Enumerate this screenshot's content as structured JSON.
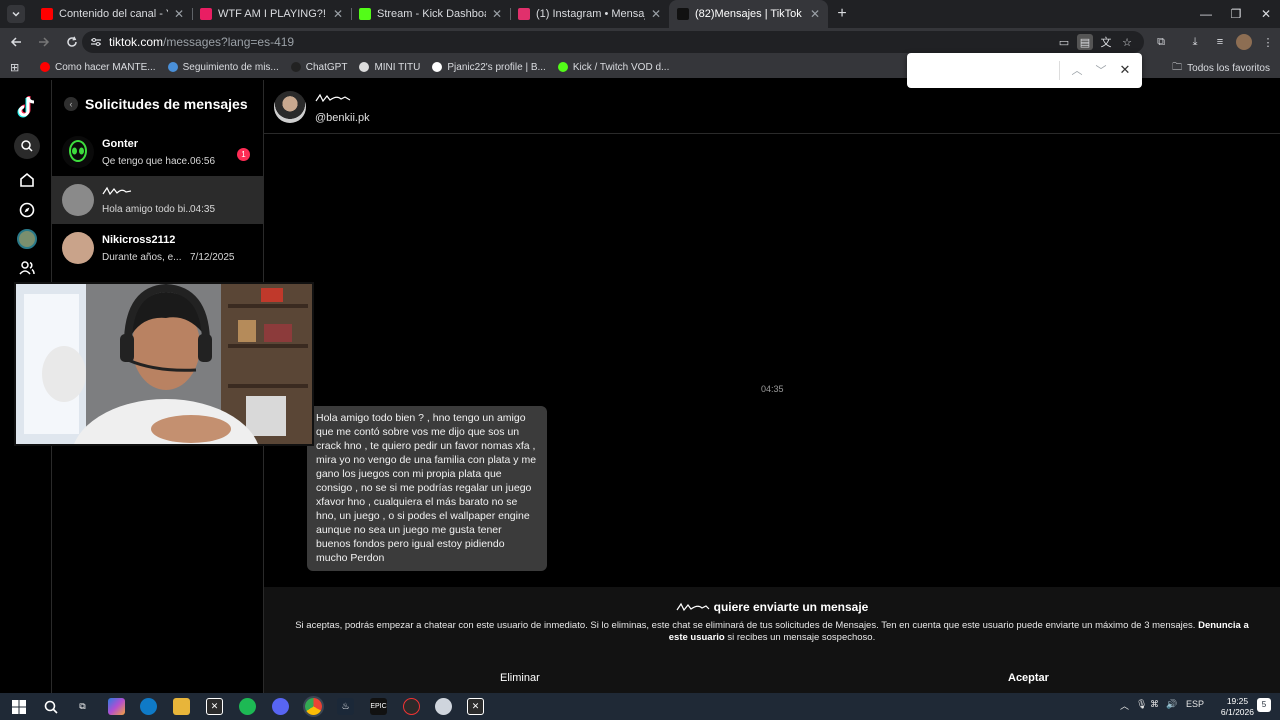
{
  "browser": {
    "tabs": [
      {
        "label": "Contenido del canal - YouTube",
        "color": "#ff0000",
        "active": false
      },
      {
        "label": "WTF AM I PLAYING?! - Keymailer",
        "color": "#e91e63",
        "active": false
      },
      {
        "label": "Stream - Kick Dashboard",
        "color": "#53fc18",
        "active": false
      },
      {
        "label": "(1) Instagram • Mensajes",
        "color": "#e1306c",
        "active": false
      },
      {
        "label": "(82)Mensajes | TikTok",
        "color": "#111111",
        "active": true
      }
    ],
    "new_tab": "+",
    "url_host": "tiktok.com",
    "url_path": "/messages?lang=es-419",
    "bookmarks": [
      {
        "label": "Como hacer MANTE...",
        "color": "#ff0000"
      },
      {
        "label": "Seguimiento de mis...",
        "color": "#4a90d9"
      },
      {
        "label": "ChatGPT",
        "color": "#222222"
      },
      {
        "label": "MINI TITU",
        "color": "#dddddd"
      },
      {
        "label": "Pjanic22's profile | B...",
        "color": "#ffffff"
      },
      {
        "label": "Kick / Twitch VOD d...",
        "color": "#53fc18"
      }
    ],
    "favorites_label": "Todos los favoritos"
  },
  "sidebar": {
    "title": "Solicitudes de mensajes",
    "conversations": [
      {
        "name": "Gonter",
        "preview": "Qe tengo que hace...",
        "time": "06:56",
        "badge": "1",
        "avatar_color": "#0a0a0a"
      },
      {
        "name": "",
        "preview": "Hola amigo todo bi...",
        "time": "04:35",
        "badge": "",
        "avatar_color": "#8a8a8a"
      },
      {
        "name": "Nikicross2112",
        "preview": "Durante años, e...",
        "time": "7/12/2025",
        "badge": "",
        "avatar_color": "#c9a38a"
      }
    ]
  },
  "chat": {
    "username": "@benkii.pk",
    "timestamp": "04:35",
    "message": "Hola amigo todo bien ? , hno tengo un amigo que me contó sobre vos me dijo que sos un crack hno , te quiero pedir un favor nomas xfa , mira yo no vengo de una familia con plata y me gano los juegos con mi propia plata que consigo , no se si me podrías regalar un juego xfavor hno , cualquiera el más barato no se hno, un juego , o si podes el wallpaper engine aunque no sea un juego me gusta tener buenos fondos pero igual estoy pidiendo mucho Perdon",
    "request_title": "quiere enviarte un mensaje",
    "request_text": "Si aceptas, podrás empezar a chatear con este usuario de inmediato. Si lo eliminas, este chat se eliminará de tus solicitudes de Mensajes. Ten en cuenta que este usuario puede enviarte un máximo de 3 mensajes.",
    "report_link": "Denuncia a este usuario",
    "request_suffix": "si recibes un mensaje sospechoso.",
    "delete_label": "Eliminar",
    "accept_label": "Aceptar"
  },
  "taskbar": {
    "lang": "ESP",
    "time": "19:25",
    "date": "6/1/2026",
    "notif_count": "5"
  },
  "colors": {
    "tiktok_red": "#fe2c55",
    "bubble": "#3b3b3b",
    "taskbar": "#1f2936"
  }
}
